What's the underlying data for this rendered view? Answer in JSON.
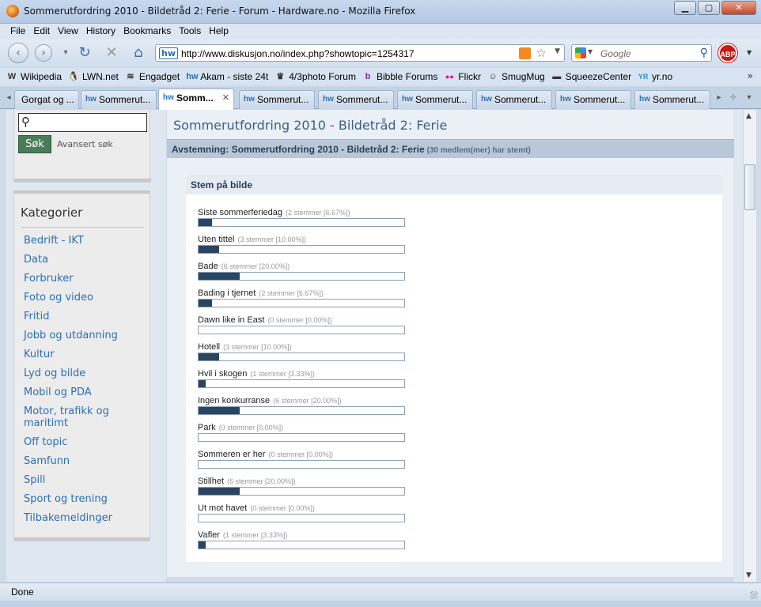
{
  "window": {
    "title": "Sommerutfordring 2010 - Bildetråd 2: Ferie - Forum - Hardware.no - Mozilla Firefox"
  },
  "menu": [
    "File",
    "Edit",
    "View",
    "History",
    "Bookmarks",
    "Tools",
    "Help"
  ],
  "nav": {
    "url": "http://www.diskusjon.no/index.php?showtopic=1254317",
    "search_placeholder": "Google",
    "abp_label": "ABP"
  },
  "bookmarks": [
    {
      "label": "Wikipedia",
      "icon": "W"
    },
    {
      "label": "LWN.net",
      "icon": "🐧"
    },
    {
      "label": "Engadget",
      "icon": "≋"
    },
    {
      "label": "Akam - siste 24t",
      "icon": "hw"
    },
    {
      "label": "4/3photo Forum",
      "icon": "♛"
    },
    {
      "label": "Bibble Forums",
      "icon": "b"
    },
    {
      "label": "Flickr",
      "icon": "●●"
    },
    {
      "label": "SmugMug",
      "icon": "☺"
    },
    {
      "label": "SqueezeCenter",
      "icon": "▬"
    },
    {
      "label": "yr.no",
      "icon": "YR"
    }
  ],
  "tabs": [
    {
      "label": "Gorgat og ...",
      "icon": "◉",
      "active": false
    },
    {
      "label": "Sommerut...",
      "icon": "hw",
      "active": false
    },
    {
      "label": "Somm...",
      "icon": "hw",
      "active": true
    },
    {
      "label": "Sommerut...",
      "icon": "hw",
      "active": false
    },
    {
      "label": "Sommerut...",
      "icon": "hw",
      "active": false
    },
    {
      "label": "Sommerut...",
      "icon": "hw",
      "active": false
    },
    {
      "label": "Sommerut...",
      "icon": "hw",
      "active": false
    },
    {
      "label": "Sommerut...",
      "icon": "hw",
      "active": false
    },
    {
      "label": "Sommerut...",
      "icon": "hw",
      "active": false
    }
  ],
  "sidebar": {
    "search_button": "Søk",
    "advanced_search": "Avansert søk",
    "categories_heading": "Kategorier",
    "categories": [
      "Bedrift - IKT",
      "Data",
      "Forbruker",
      "Foto og video",
      "Fritid",
      "Jobb og utdanning",
      "Kultur",
      "Lyd og bilde",
      "Mobil og PDA",
      "Motor, trafikk og maritimt",
      "Off topic",
      "Samfunn",
      "Spill",
      "Sport og trening",
      "Tilbakemeldinger"
    ]
  },
  "main": {
    "page_title": "Sommerutfordring 2010 - Bildetråd 2: Ferie",
    "poll_title": "Avstemning: Sommerutfordring 2010 - Bildetråd 2: Ferie",
    "poll_count": "(30 medlem(mer) har stemt)",
    "question": "Stem på bilde",
    "options": [
      {
        "label": "Siste sommerferiedag",
        "votes": "(2 stemmer [6.67%])",
        "percent": 6.67
      },
      {
        "label": "Uten tittel",
        "votes": "(3 stemmer [10.00%])",
        "percent": 10.0
      },
      {
        "label": "Bade",
        "votes": "(6 stemmer [20.00%])",
        "percent": 20.0
      },
      {
        "label": "Bading i tjernet",
        "votes": "(2 stemmer [6.67%])",
        "percent": 6.67
      },
      {
        "label": "Dawn like in East",
        "votes": "(0 stemmer [0.00%])",
        "percent": 0
      },
      {
        "label": "Hotell",
        "votes": "(3 stemmer [10.00%])",
        "percent": 10.0
      },
      {
        "label": "Hvil i skogen",
        "votes": "(1 stemmer [3.33%])",
        "percent": 3.33
      },
      {
        "label": "Ingen konkurranse",
        "votes": "(6 stemmer [20.00%])",
        "percent": 20.0
      },
      {
        "label": "Park",
        "votes": "(0 stemmer [0.00%])",
        "percent": 0
      },
      {
        "label": "Sommeren er her",
        "votes": "(0 stemmer [0.00%])",
        "percent": 0
      },
      {
        "label": "Stillhet",
        "votes": "(6 stemmer [20.00%])",
        "percent": 20.0
      },
      {
        "label": "Ut mot havet",
        "votes": "(0 stemmer [0.00%])",
        "percent": 0
      },
      {
        "label": "Vafler",
        "votes": "(1 stemmer [3.33%])",
        "percent": 3.33
      }
    ]
  },
  "status": {
    "text": "Done"
  },
  "colors": {
    "poll_fill": "#2b4460",
    "link": "#2a6fb6",
    "search_button": "#4a7c59"
  }
}
